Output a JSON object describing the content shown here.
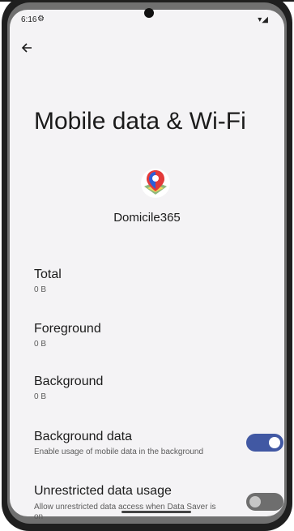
{
  "status_bar": {
    "time": "6:16"
  },
  "page": {
    "title": "Mobile data & Wi-Fi"
  },
  "app": {
    "name": "Domicile365"
  },
  "stats": [
    {
      "label": "Total",
      "value": "0 B"
    },
    {
      "label": "Foreground",
      "value": "0 B"
    },
    {
      "label": "Background",
      "value": "0 B"
    }
  ],
  "settings": [
    {
      "title": "Background data",
      "description": "Enable usage of mobile data in the background",
      "enabled": true
    },
    {
      "title": "Unrestricted data usage",
      "description": "Allow unrestricted data access when Data Saver is on",
      "enabled": false
    }
  ],
  "colors": {
    "accent": "#4158a3",
    "icon_red": "#e33a3a",
    "icon_blue": "#2d5fd8"
  }
}
